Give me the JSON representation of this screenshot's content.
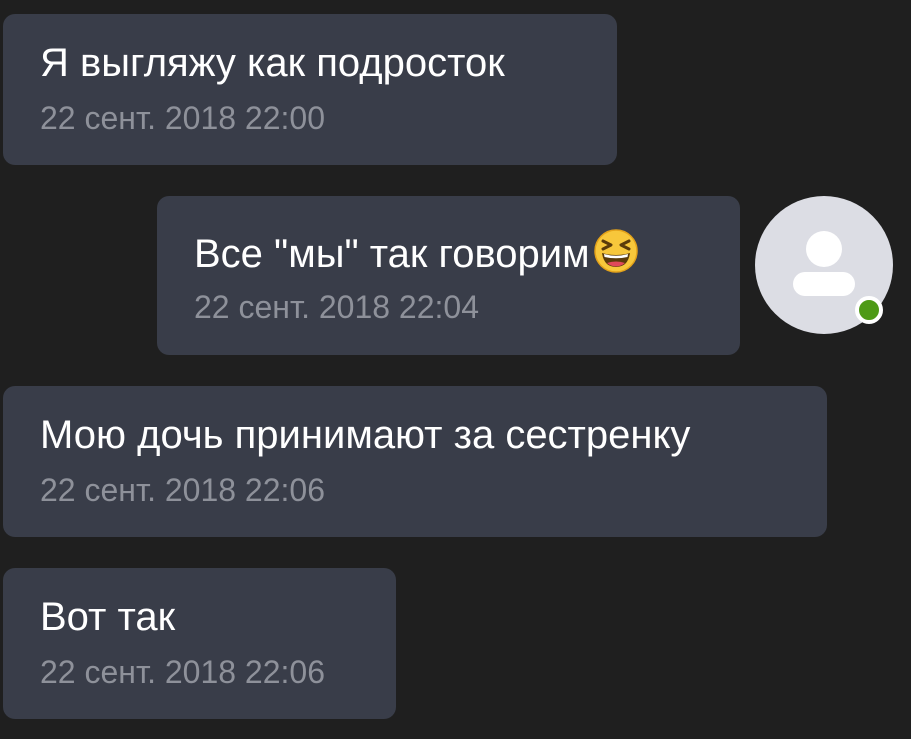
{
  "chat": {
    "messages": [
      {
        "text": "Я выгляжу как подросток",
        "time": "22 сент. 2018 22:00",
        "side": "incoming"
      },
      {
        "text": "Все \"мы\" так говорим",
        "emoji": "grinning-squinting-face",
        "time": "22 сент. 2018 22:04",
        "side": "outgoing"
      },
      {
        "text": "Мою дочь принимают за сестренку",
        "time": "22 сент. 2018 22:06",
        "side": "incoming"
      },
      {
        "text": "Вот так",
        "time": "22 сент. 2018 22:06",
        "side": "incoming"
      }
    ],
    "avatar": {
      "icon": "user-silhouette-icon",
      "status": "online",
      "status_color": "#4e9a16"
    }
  },
  "colors": {
    "background": "#1f1f1f",
    "bubble": "#393d49",
    "text": "#ffffff",
    "timestamp": "#8e919a"
  }
}
